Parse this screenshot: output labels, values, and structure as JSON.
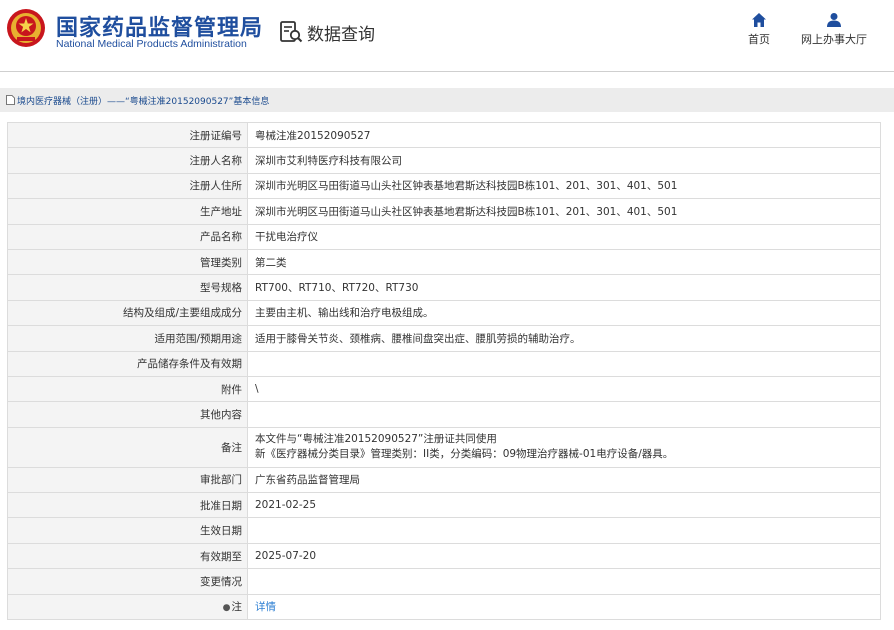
{
  "header": {
    "title_cn": "国家药品监督管理局",
    "title_en": "National Medical Products Administration",
    "query_label": "数据查询",
    "nav": [
      {
        "label": "首页",
        "icon": "home-icon"
      },
      {
        "label": "网上办事大厅",
        "icon": "user-icon"
      }
    ]
  },
  "breadcrumb": {
    "text": "境内医疗器械（注册）——“粤械注准20152090527”基本信息"
  },
  "record": {
    "rows": [
      {
        "label": "注册证编号",
        "value": "粤械注准20152090527"
      },
      {
        "label": "注册人名称",
        "value": "深圳市艾利特医疗科技有限公司"
      },
      {
        "label": "注册人住所",
        "value": "深圳市光明区马田街道马山头社区钟表基地君斯达科技园B栋101、201、301、401、501"
      },
      {
        "label": "生产地址",
        "value": "深圳市光明区马田街道马山头社区钟表基地君斯达科技园B栋101、201、301、401、501"
      },
      {
        "label": "产品名称",
        "value": "干扰电治疗仪"
      },
      {
        "label": "管理类别",
        "value": "第二类"
      },
      {
        "label": "型号规格",
        "value": "RT700、RT710、RT720、RT730"
      },
      {
        "label": "结构及组成/主要组成成分",
        "value": "主要由主机、输出线和治疗电极组成。"
      },
      {
        "label": "适用范围/预期用途",
        "value": "适用于膝骨关节炎、颈椎病、腰椎间盘突出症、腰肌劳损的辅助治疗。"
      },
      {
        "label": "产品储存条件及有效期",
        "value": ""
      },
      {
        "label": "附件",
        "value": "\\"
      },
      {
        "label": "其他内容",
        "value": ""
      }
    ],
    "remark": {
      "label": "备注",
      "line1": "本文件与“粤械注准20152090527”注册证共同使用",
      "line2": "新《医疗器械分类目录》管理类别：II类，分类编码：09物理治疗器械-01电疗设备/器具。"
    },
    "rows2": [
      {
        "label": "审批部门",
        "value": "广东省药品监督管理局"
      },
      {
        "label": "批准日期",
        "value": "2021-02-25"
      },
      {
        "label": "生效日期",
        "value": ""
      },
      {
        "label": "有效期至",
        "value": "2025-07-20"
      },
      {
        "label": "变更情况",
        "value": ""
      }
    ],
    "note": {
      "label": "注",
      "link": "详情"
    }
  }
}
